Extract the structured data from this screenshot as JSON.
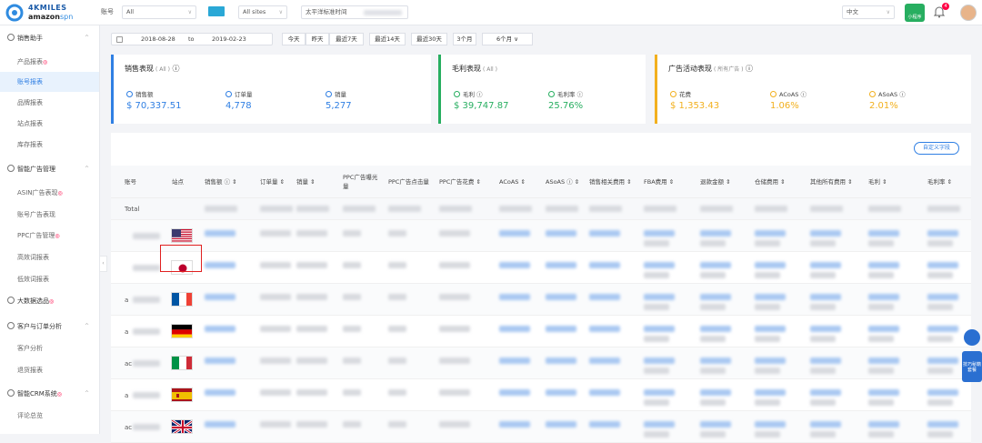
{
  "logo": {
    "brand": "4KMILES",
    "product": "amazon",
    "product_suffix": "spn"
  },
  "topbar": {
    "account_label": "账号",
    "account_value": "All",
    "site_value": "All sites",
    "timezone": "太平洋标准时间",
    "language": "中文",
    "mini_program": "小程序",
    "notification_count": "4"
  },
  "sidebar": {
    "groups": [
      {
        "label": "销售助手",
        "items": [
          {
            "label": "产品报表",
            "hot": true
          },
          {
            "label": "账号报表",
            "active": true
          },
          {
            "label": "品牌报表"
          },
          {
            "label": "站点报表"
          },
          {
            "label": "库存报表"
          }
        ]
      },
      {
        "label": "智能广告管理",
        "items": [
          {
            "label": "ASIN广告表现",
            "hot": true
          },
          {
            "label": "账号广告表现"
          },
          {
            "label": "PPC广告管理",
            "hot": true
          },
          {
            "label": "高效词报表"
          },
          {
            "label": "低效词报表"
          }
        ]
      },
      {
        "label": "大数据选品",
        "hot": true,
        "items": []
      },
      {
        "label": "客户与订单分析",
        "items": [
          {
            "label": "客户分析"
          },
          {
            "label": "退货报表"
          }
        ]
      },
      {
        "label": "智能CRM系统",
        "hot": true,
        "items": [
          {
            "label": "评论总览"
          }
        ]
      }
    ]
  },
  "datebar": {
    "start": "2018-08-28",
    "to": "to",
    "end": "2019-02-23",
    "quick": [
      "今天",
      "昨天",
      "最近7天",
      "最近14天",
      "最近30天",
      "3个月",
      "6个月"
    ]
  },
  "cards": {
    "sales": {
      "title": "销售表现",
      "scope": "( All )",
      "metrics": [
        {
          "label": "销售额",
          "value": "$ 70,337.51"
        },
        {
          "label": "订单量",
          "value": "4,778"
        },
        {
          "label": "销量",
          "value": "5,277"
        }
      ]
    },
    "profit": {
      "title": "毛利表现",
      "scope": "( All )",
      "metrics": [
        {
          "label": "毛利",
          "value": "$ 39,747.87"
        },
        {
          "label": "毛利率",
          "value": "25.76%"
        }
      ]
    },
    "ads": {
      "title": "广告活动表现",
      "scope": "( 所有广告 )",
      "metrics": [
        {
          "label": "花费",
          "value": "$ 1,353.43"
        },
        {
          "label": "ACoAS",
          "value": "1.06%"
        },
        {
          "label": "ASoAS",
          "value": "2.01%"
        }
      ]
    }
  },
  "table": {
    "custom_button": "自定义字段",
    "headers": [
      "账号",
      "站点",
      "销售额",
      "订单量",
      "销量",
      "PPC广告曝光量",
      "PPC广告点击量",
      "PPC广告花费",
      "ACoAS",
      "ASoAS",
      "销售相关费用",
      "FBA费用",
      "退款金额",
      "仓储费用",
      "其他所有费用",
      "毛利",
      "毛利率"
    ],
    "total_label": "Total",
    "rows": [
      {
        "account": "",
        "flag": "us"
      },
      {
        "account": "",
        "flag": "jp"
      },
      {
        "account": "a",
        "flag": "fr"
      },
      {
        "account": "a",
        "flag": "de"
      },
      {
        "account": "ac",
        "flag": "it"
      },
      {
        "account": "a",
        "flag": "es"
      },
      {
        "account": "ac",
        "flag": "uk"
      }
    ]
  },
  "float_panel": {
    "label": "技巧秘籍套餐"
  }
}
